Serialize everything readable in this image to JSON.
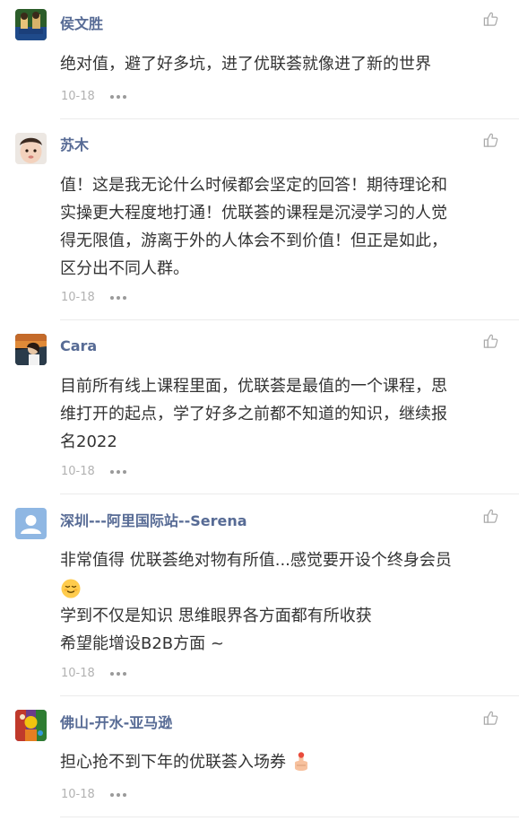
{
  "comments": [
    {
      "name": "侯文胜",
      "lines": [
        "绝对值，避了好多坑，进了优联荟就像进了新的世界"
      ],
      "date": "10-18"
    },
    {
      "name": "苏木",
      "lines": [
        "值！这是我无论什么时候都会坚定的回答！期待理论和",
        "实操更大程度地打通！优联荟的课程是沉浸学习的人觉",
        "得无限值，游离于外的人体会不到价值！但正是如此，",
        "区分出不同人群。"
      ],
      "date": "10-18"
    },
    {
      "name": "Cara",
      "lines": [
        "目前所有线上课程里面，优联荟是最值的一个课程，思",
        "维打开的起点，学了好多之前都不知道的知识，继续报",
        "名2022"
      ],
      "date": "10-18"
    },
    {
      "name": "深圳---阿里国际站--Serena",
      "lines": [
        "非常值得 优联荟绝对物有所值...感觉要开设个终身会员",
        "",
        "学到不仅是知识 思维眼界各方面都有所收获",
        "希望能增设B2B方面 ~"
      ],
      "date": "10-18"
    },
    {
      "name": "佛山-开水-亚马逊",
      "lines": [
        "担心抢不到下年的优联荟入场券"
      ],
      "date": "10-18"
    }
  ],
  "icons": {
    "like": "thumbs-up-outline-icon",
    "more": "more-dots-icon",
    "emoji_relieved": "relieved-face-emoji",
    "emoji_hand": "raised-finger-emoji"
  },
  "colors": {
    "name": "#576b95",
    "text": "#333333",
    "meta": "#b2b2b2",
    "divider": "#ebebeb"
  }
}
